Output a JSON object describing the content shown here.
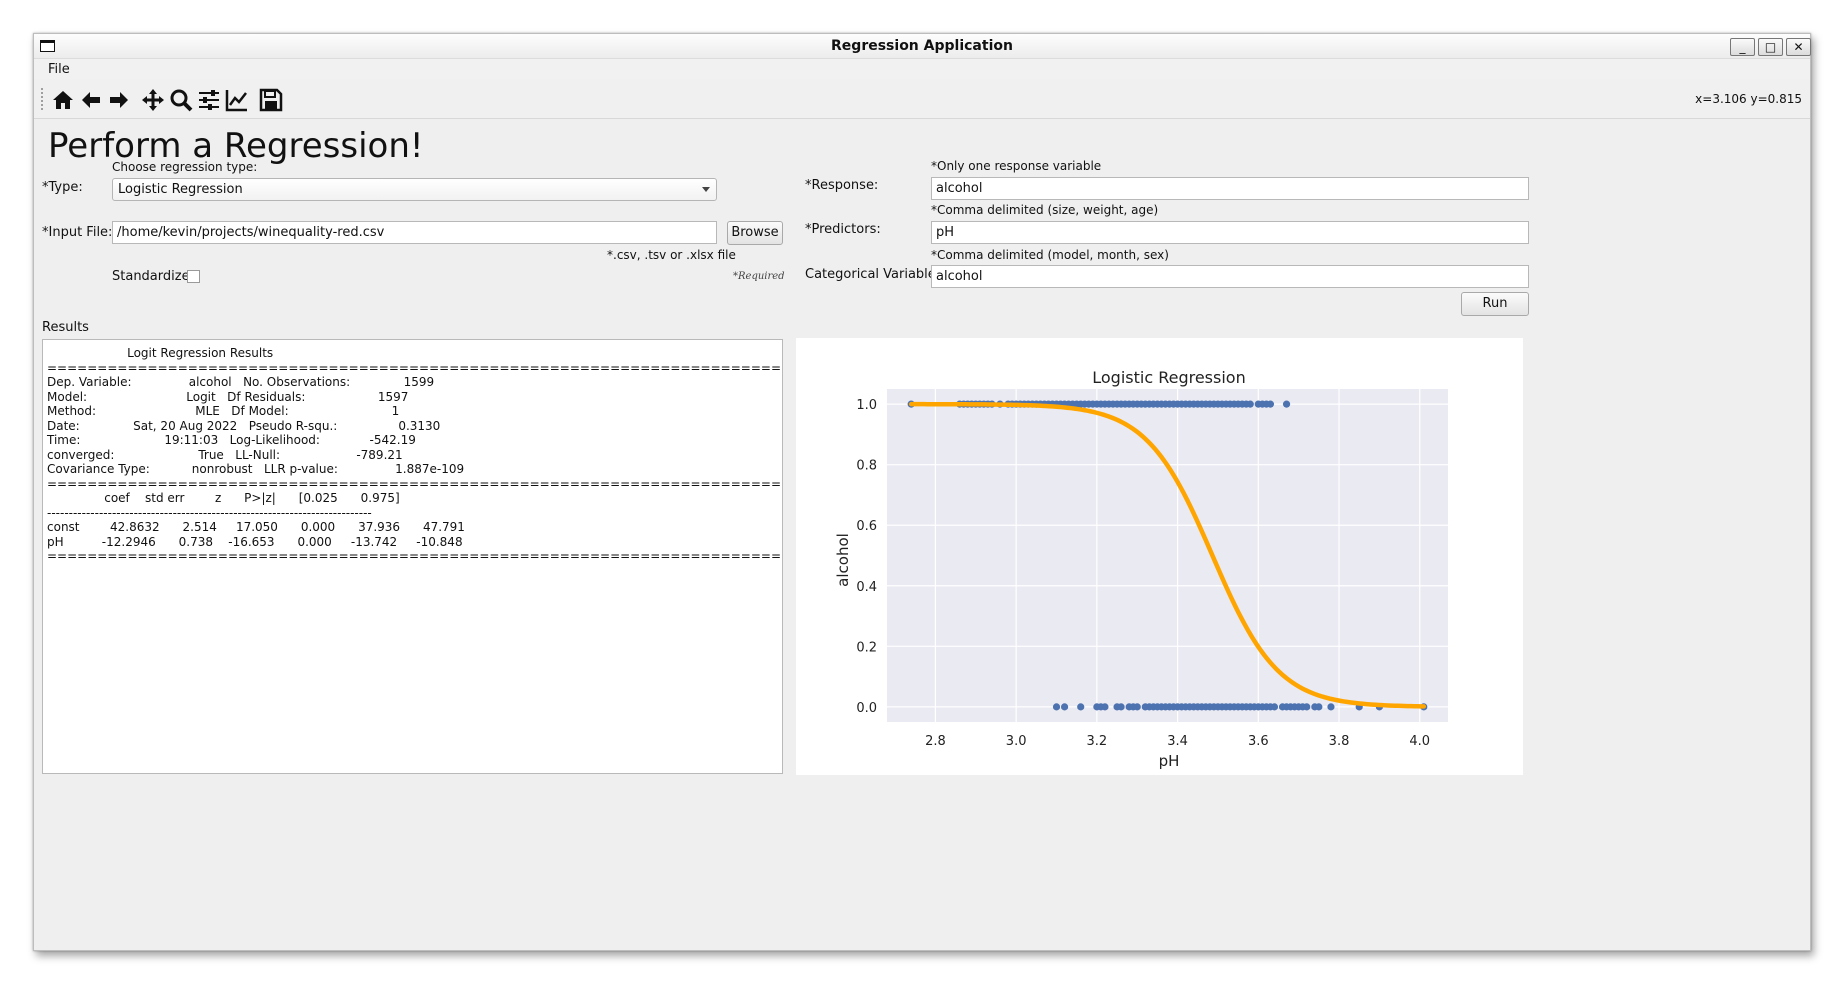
{
  "window": {
    "title": "Regression Application"
  },
  "window_controls": {
    "minimize": "_",
    "maximize": "□",
    "close": "✕"
  },
  "menu": {
    "file": "File"
  },
  "toolbar": {
    "buttons": [
      "home-icon",
      "back-arrow-icon",
      "forward-arrow-icon",
      "pan-icon",
      "zoom-icon",
      "configure-subplots-icon",
      "edit-axis-icon",
      "save-icon"
    ],
    "coords": "x=3.106 y=0.815"
  },
  "page": {
    "heading": "Perform a Regression!"
  },
  "form": {
    "type_hint": "Choose regression type:",
    "type_label": "*Type:",
    "type_value": "Logistic Regression",
    "input_file_label": "*Input File:",
    "input_file_value": "/home/kevin/projects/winequality-red.csv",
    "browse_label": "Browse",
    "file_hint": "*.csv, .tsv or .xlsx file",
    "standardize_label": "Standardize:",
    "required_note": "*Required",
    "response_hint": "*Only one response variable",
    "response_label": "*Response:",
    "response_value": "alcohol",
    "predictors_hint": "*Comma delimited (size, weight, age)",
    "predictors_label": "*Predictors:",
    "predictors_value": "pH",
    "categorical_hint": "*Comma delimited (model, month, sex)",
    "categorical_label": "Categorical Variables:",
    "categorical_value": "alcohol",
    "run_label": "Run"
  },
  "results": {
    "label": "Results",
    "text": "                     Logit Regression Results\n===========================================================================\nDep. Variable:               alcohol   No. Observations:              1599\nModel:                          Logit   Df Residuals:                   1597\nMethod:                          MLE   Df Model:                           1\nDate:              Sat, 20 Aug 2022   Pseudo R-squ.:                0.3130\nTime:                      19:11:03   Log-Likelihood:             -542.19\nconverged:                      True   LL-Null:                    -789.21\nCovariance Type:           nonrobust   LLR p-value:               1.887e-109\n===========================================================================\n               coef    std err        z      P>|z|      [0.025      0.975]\n---------------------------------------------------------------------------\nconst        42.8632      2.514     17.050      0.000      37.936      47.791\npH          -12.2946      0.738    -16.653      0.000     -13.742     -10.848\n==========================================================================="
  },
  "chart_data": {
    "type": "scatter",
    "title": "Logistic Regression",
    "xlabel": "pH",
    "ylabel": "alcohol",
    "xlim": [
      2.68,
      4.07
    ],
    "ylim": [
      -0.05,
      1.05
    ],
    "xticks": [
      "2.8",
      "3.0",
      "3.2",
      "3.4",
      "3.6",
      "3.8",
      "4.0"
    ],
    "yticks": [
      "0.0",
      "0.2",
      "0.4",
      "0.6",
      "0.8",
      "1.0"
    ],
    "grid": true,
    "colors": {
      "points": "#4c72b0",
      "curve": "#ffa500",
      "background": "#eaeaf2"
    },
    "series": [
      {
        "type": "scatter",
        "points_y1": [
          2.74,
          2.86,
          2.87,
          2.88,
          2.89,
          2.9,
          2.91,
          2.92,
          2.93,
          2.94,
          2.96,
          2.98,
          2.99,
          3.0,
          3.01,
          3.02,
          3.03,
          3.04,
          3.05,
          3.06,
          3.07,
          3.08,
          3.09,
          3.1,
          3.11,
          3.12,
          3.13,
          3.14,
          3.15,
          3.16,
          3.17,
          3.18,
          3.19,
          3.2,
          3.21,
          3.22,
          3.23,
          3.24,
          3.25,
          3.26,
          3.27,
          3.28,
          3.29,
          3.3,
          3.31,
          3.32,
          3.33,
          3.34,
          3.35,
          3.36,
          3.37,
          3.38,
          3.39,
          3.4,
          3.41,
          3.42,
          3.43,
          3.44,
          3.45,
          3.46,
          3.47,
          3.48,
          3.49,
          3.5,
          3.51,
          3.52,
          3.53,
          3.54,
          3.55,
          3.56,
          3.57,
          3.58,
          3.6,
          3.61,
          3.62,
          3.63,
          3.67
        ],
        "points_y0": [
          3.1,
          3.12,
          3.16,
          3.2,
          3.21,
          3.22,
          3.25,
          3.26,
          3.28,
          3.29,
          3.3,
          3.32,
          3.33,
          3.34,
          3.35,
          3.36,
          3.37,
          3.38,
          3.39,
          3.4,
          3.41,
          3.42,
          3.43,
          3.44,
          3.45,
          3.46,
          3.47,
          3.48,
          3.49,
          3.5,
          3.51,
          3.52,
          3.53,
          3.54,
          3.55,
          3.56,
          3.57,
          3.58,
          3.59,
          3.6,
          3.61,
          3.62,
          3.63,
          3.64,
          3.66,
          3.67,
          3.68,
          3.69,
          3.7,
          3.71,
          3.72,
          3.74,
          3.75,
          3.78,
          3.85,
          3.9,
          4.01
        ]
      },
      {
        "type": "line",
        "model": {
          "const": 42.8632,
          "pH": -12.2946
        },
        "x_range": [
          2.74,
          4.01
        ]
      }
    ]
  }
}
